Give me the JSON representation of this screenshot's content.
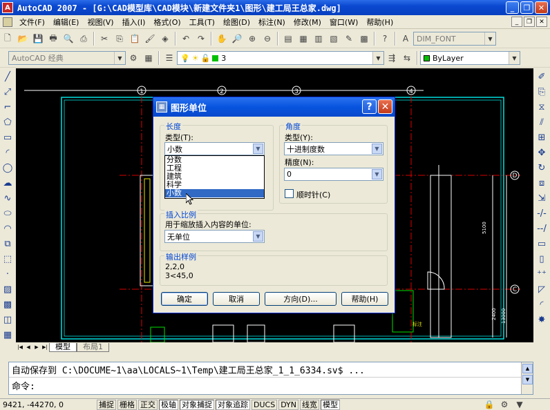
{
  "window": {
    "title": "AutoCAD 2007 - [G:\\CAD模型库\\CAD模块\\新建文件夹1\\图形\\建工局王总家.dwg]"
  },
  "menu": {
    "items": [
      "文件(F)",
      "编辑(E)",
      "视图(V)",
      "插入(I)",
      "格式(O)",
      "工具(T)",
      "绘图(D)",
      "标注(N)",
      "修改(M)",
      "窗口(W)",
      "帮助(H)"
    ]
  },
  "toolbar": {
    "text_style": "DIM_FONT",
    "workspace": "AutoCAD 经典",
    "layer": "3",
    "color": "ByLayer"
  },
  "drawing": {
    "grid_labels": [
      "1",
      "2",
      "3",
      "4",
      "D",
      "C"
    ],
    "dims": [
      "5100",
      "2400",
      "13000"
    ],
    "small_label": "标注"
  },
  "tabs": {
    "model": "模型",
    "layout": "布局1"
  },
  "command": {
    "history": "自动保存到 C:\\DOCUME~1\\aa\\LOCALS~1\\Temp\\建工局王总家_1_1_6334.sv$ ...",
    "prompt": "命令:"
  },
  "status": {
    "coords": "9421,  -44270, 0",
    "buttons": [
      "捕捉",
      "栅格",
      "正交",
      "极轴",
      "对象捕捉",
      "对象追踪",
      "DUCS",
      "DYN",
      "线宽",
      "模型"
    ]
  },
  "dialog": {
    "title": "图形单位",
    "length": {
      "group": "长度",
      "type_label": "类型(T):",
      "type_value": "小数",
      "options": [
        "分数",
        "工程",
        "建筑",
        "科学",
        "小数"
      ]
    },
    "angle": {
      "group": "角度",
      "type_label": "类型(Y):",
      "type_value": "十进制度数",
      "precision_label": "精度(N):",
      "precision_value": "0",
      "clockwise_label": "顺时针(C)"
    },
    "insert": {
      "group": "插入比例",
      "label": "用于缩放插入内容的单位:",
      "value": "无单位"
    },
    "sample": {
      "group": "输出样例",
      "line1": "2,2,0",
      "line2": "3<45,0"
    },
    "buttons": {
      "ok": "确定",
      "cancel": "取消",
      "direction": "方向(D)...",
      "help": "帮助(H)"
    }
  }
}
